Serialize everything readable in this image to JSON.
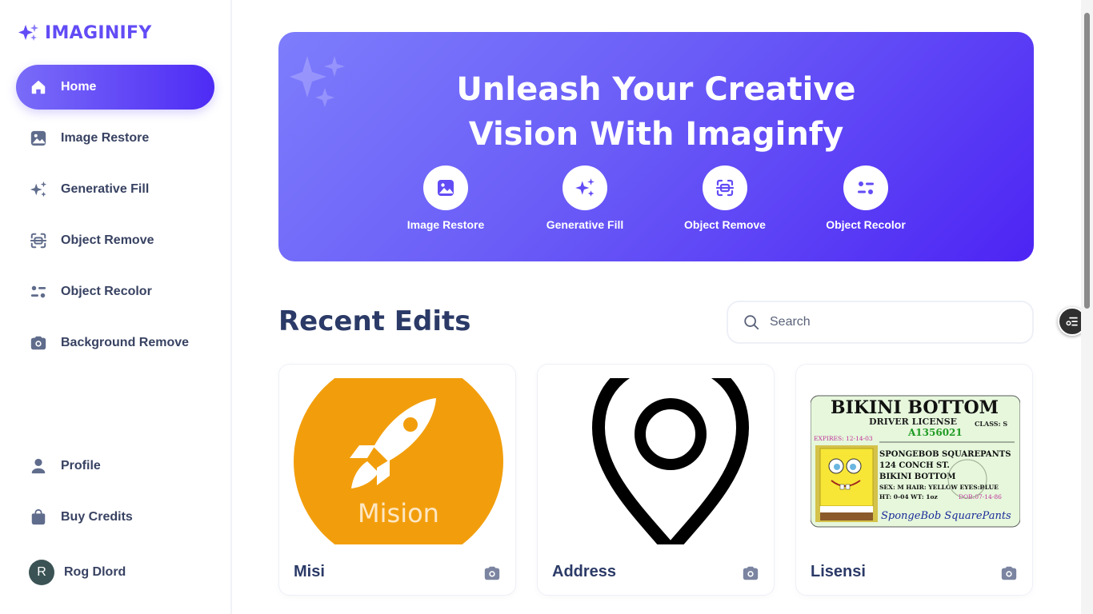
{
  "app": {
    "name": "IMAGINIFY"
  },
  "sidebar": {
    "items": [
      {
        "label": "Home",
        "icon": "home-icon",
        "active": true
      },
      {
        "label": "Image Restore",
        "icon": "image-icon"
      },
      {
        "label": "Generative Fill",
        "icon": "sparkles-icon"
      },
      {
        "label": "Object Remove",
        "icon": "scan-icon"
      },
      {
        "label": "Object Recolor",
        "icon": "filter-icon"
      },
      {
        "label": "Background Remove",
        "icon": "camera-icon"
      }
    ],
    "bottom_items": [
      {
        "label": "Profile",
        "icon": "user-icon"
      },
      {
        "label": "Buy Credits",
        "icon": "bag-icon"
      }
    ],
    "user": {
      "initial": "R",
      "name": "Rog Dlord"
    }
  },
  "banner": {
    "title_line1": "Unleash Your Creative",
    "title_line2": "Vision With Imaginfy",
    "tools": [
      {
        "label": "Image Restore",
        "icon": "image-icon"
      },
      {
        "label": "Generative Fill",
        "icon": "sparkles-icon"
      },
      {
        "label": "Object Remove",
        "icon": "scan-icon"
      },
      {
        "label": "Object Recolor",
        "icon": "filter-icon"
      }
    ]
  },
  "recent": {
    "title": "Recent Edits",
    "search_placeholder": "Search",
    "cards": [
      {
        "title": "Misi",
        "image_text": "Mision",
        "type_icon": "camera-icon"
      },
      {
        "title": "Address",
        "type_icon": "camera-icon"
      },
      {
        "title": "Lisensi",
        "type_icon": "camera-icon",
        "license": {
          "heading": "BIKINI BOTTOM",
          "subheading": "DRIVER LICENSE",
          "class": "CLASS: S",
          "number": "A1356021",
          "expires": "EXPIRES: 12-14-03",
          "name": "SPONGEBOB SQUAREPANTS",
          "address1": "124 CONCH ST.",
          "address2": "BIKINI BOTTOM",
          "details1": "SEX: M HAIR: YELLOW EYES:BLUE",
          "details2": "HT: 0-04 WT: 1oz",
          "dob": "DOB:07-14-86",
          "signature": "SpongeBob SquarePants"
        }
      }
    ]
  },
  "colors": {
    "accent": "#624cf5",
    "title": "#2b3a67",
    "mision_orange": "#f29e0c"
  }
}
